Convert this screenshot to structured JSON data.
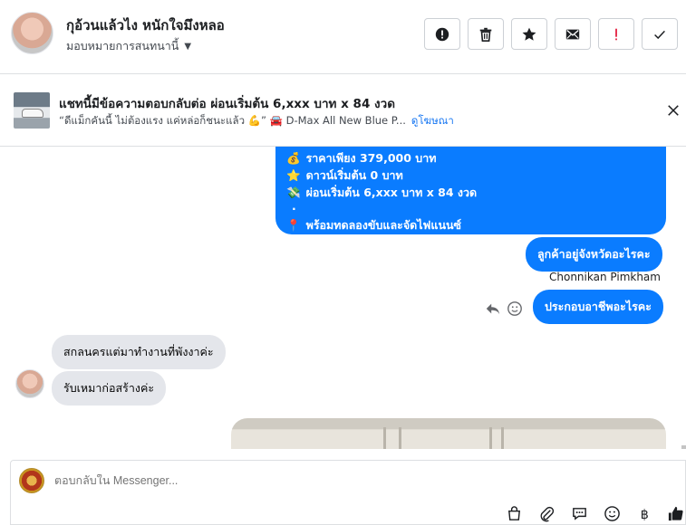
{
  "header": {
    "contact_name": "กุอ้วนแล้วไง หนักใจมึงหลอ",
    "assign_label": "มอบหมายการสนทนานี้",
    "buttons": [
      "mark-spam",
      "delete",
      "star",
      "mark-unread",
      "follow-up",
      "mark-done"
    ]
  },
  "ad": {
    "title": "แชทนี้มีข้อความตอบกลับต่อ ผ่อนเริ่มต้น 6,xxx บาท x 84 งวด",
    "snippet": "“ดีแม็กคันนี้ ไม่ต้องแรง แค่หล่อก็ชนะแล้ว 💪” 🚘 D-Max All New Blue P...",
    "link": "ดูโฆษณา"
  },
  "messages": {
    "big_bubble_lines": [
      {
        "icon": "💰",
        "text": "ราคาเพียง 379,000 บาท"
      },
      {
        "icon": "⭐",
        "text": "ดาวน์เริ่มต้น 0 บาท"
      },
      {
        "icon": "💸",
        "text": "ผ่อนเริ่มต้น 6,xxx บาท x 84 งวด"
      },
      {
        "icon": "",
        "text": "."
      },
      {
        "icon": "📍",
        "text": "พร้อมทดลองขับและจัดไฟแนนซ์"
      }
    ],
    "outgoing_1": "ลูกค้าอยู่จังหวัดอะไรคะ",
    "sender_name": "Chonnikan Pimkham",
    "outgoing_2": "ประกอบอาชีพอะไรคะ",
    "incoming_1": "สกลนครแต่มาทำงานที่พังงาค่ะ",
    "incoming_2": "รับเหมาก่อสร้างค่ะ"
  },
  "composer": {
    "placeholder": "ตอบกลับใน Messenger...",
    "tools": [
      "shopping-bag-icon",
      "paperclip-icon",
      "saved-reply-icon",
      "emoji-icon",
      "baht-icon",
      "thumbs-up-icon"
    ]
  },
  "colors": {
    "accent": "#0a7cff",
    "grey_bubble": "#e4e6eb",
    "link": "#1877f2"
  }
}
